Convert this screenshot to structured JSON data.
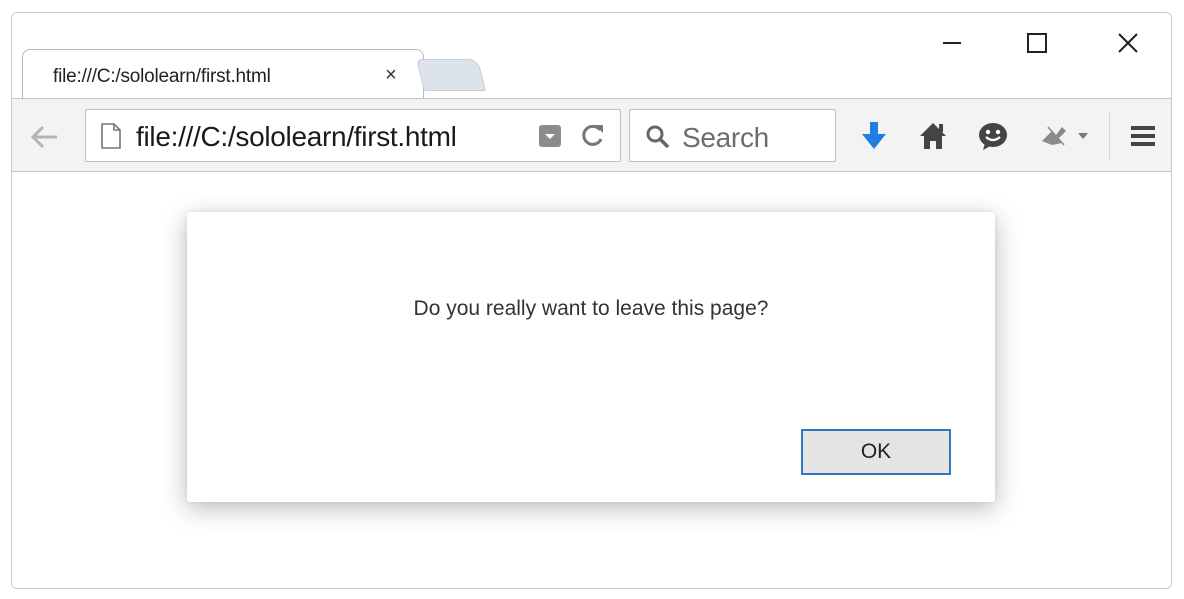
{
  "tab": {
    "title": "file:///C:/sololearn/first.html",
    "close_glyph": "×"
  },
  "toolbar": {
    "url": "file:///C:/sololearn/first.html",
    "search_placeholder": "Search"
  },
  "dialog": {
    "message": "Do you really want to leave this page?",
    "ok_label": "OK"
  },
  "icons": {
    "back": "back-arrow-icon",
    "page": "page-icon",
    "reader": "dropdown-marker-icon",
    "reload": "reload-icon",
    "search": "search-icon",
    "download": "download-icon",
    "home": "home-icon",
    "chat": "chat-icon",
    "extension": "extension-icon",
    "menu": "hamburger-menu-icon"
  },
  "colors": {
    "accent": "#2f77bf",
    "download": "#1e7fe0"
  }
}
